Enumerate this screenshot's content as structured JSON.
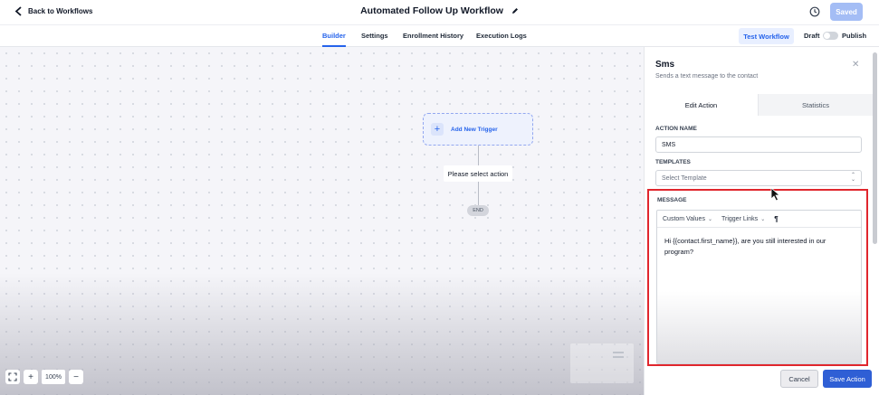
{
  "header": {
    "back_label": "Back to Workflows",
    "workflow_title": "Automated Follow Up Workflow",
    "saved_label": "Saved"
  },
  "nav_tabs": {
    "builder": "Builder",
    "settings": "Settings",
    "enrollment_history": "Enrollment History",
    "execution_logs": "Execution Logs",
    "active": "Builder"
  },
  "toolbar": {
    "test_workflow": "Test Workflow",
    "draft": "Draft",
    "publish": "Publish",
    "publish_toggle_on": false
  },
  "canvas": {
    "add_trigger": "Add New Trigger",
    "select_action": "Please select action",
    "end": "END",
    "zoom": "100%"
  },
  "panel": {
    "title": "Sms",
    "subtitle": "Sends a text message to the contact",
    "tabs": [
      "Edit Action",
      "Statistics"
    ],
    "action_name_label": "ACTION NAME",
    "action_name_value": "SMS",
    "templates_label": "TEMPLATES",
    "templates_placeholder": "Select Template",
    "message_label": "MESSAGE",
    "custom_values": "Custom Values",
    "trigger_links": "Trigger Links",
    "message_text": "Hi {{contact.first_name}}, are you still interested in our program?",
    "cancel": "Cancel",
    "save_action": "Save Action"
  },
  "colors": {
    "accent": "#2563eb",
    "highlight_border": "#e0262d",
    "save_button": "#2f5fd5",
    "saved_button": "#a4bdf5"
  }
}
